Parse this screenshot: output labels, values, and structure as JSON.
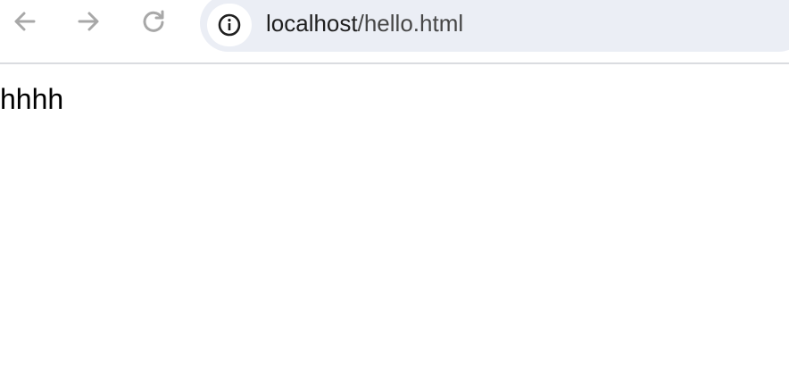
{
  "browser": {
    "url_host": "localhost",
    "url_path": "/hello.html",
    "icons": {
      "back": "arrow-left-icon",
      "forward": "arrow-right-icon",
      "reload": "reload-icon",
      "site_info": "info-circle-icon"
    },
    "colors": {
      "omnibox_bg": "#ebeef5",
      "icon_gray": "#a8a8a8",
      "text": "#1f1f1f"
    }
  },
  "page": {
    "body_text": "hhhh"
  }
}
